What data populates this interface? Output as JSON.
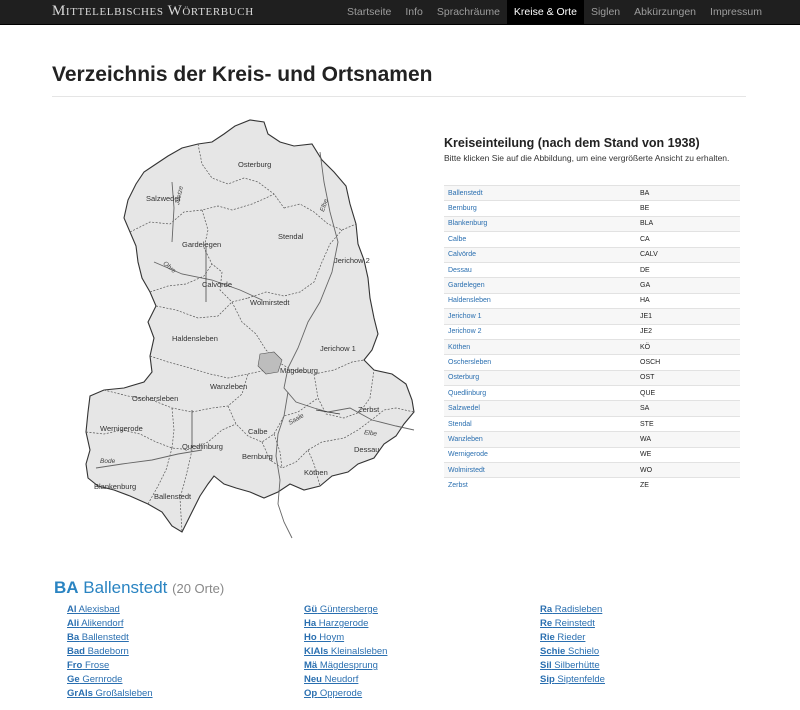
{
  "brand": "Mittelelbisches Wörterbuch",
  "nav": [
    "Startseite",
    "Info",
    "Sprachräume",
    "Kreise & Orte",
    "Siglen",
    "Abkürzungen",
    "Impressum"
  ],
  "nav_active": "Kreise & Orte",
  "page_title": "Verzeichnis der Kreis- und Ortsnamen",
  "map": {
    "labels": [
      "Osterburg",
      "Salzwedel",
      "Gardelegen",
      "Stendal",
      "Jerichow 2",
      "Calvörde",
      "Wolmirstedt",
      "Haldensleben",
      "Jerichow 1",
      "Magdeburg",
      "Oschersleben",
      "Wanzleben",
      "Zerbst",
      "Wernigerode",
      "Calbe",
      "Dessau",
      "Quedlinburg",
      "Bernburg",
      "Köthen",
      "Blankenburg",
      "Ballenstedt"
    ],
    "rivers": [
      "Jeetze",
      "Elbe",
      "Ohre",
      "Saale",
      "Elbe",
      "Bode"
    ]
  },
  "kreise": {
    "title": "Kreiseinteilung (nach dem Stand von 1938)",
    "description": "Bitte klicken Sie auf die Abbildung, um eine vergrößerte Ansicht zu erhalten.",
    "rows": [
      {
        "name": "Ballenstedt",
        "abbr": "BA"
      },
      {
        "name": "Bernburg",
        "abbr": "BE"
      },
      {
        "name": "Blankenburg",
        "abbr": "BLA"
      },
      {
        "name": "Calbe",
        "abbr": "CA"
      },
      {
        "name": "Calvörde",
        "abbr": "CALV"
      },
      {
        "name": "Dessau",
        "abbr": "DE"
      },
      {
        "name": "Gardelegen",
        "abbr": "GA"
      },
      {
        "name": "Haldensleben",
        "abbr": "HA"
      },
      {
        "name": "Jerichow 1",
        "abbr": "JE1"
      },
      {
        "name": "Jerichow 2",
        "abbr": "JE2"
      },
      {
        "name": "Köthen",
        "abbr": "KÖ"
      },
      {
        "name": "Oschersleben",
        "abbr": "OSCH"
      },
      {
        "name": "Osterburg",
        "abbr": "OST"
      },
      {
        "name": "Quedlinburg",
        "abbr": "QUE"
      },
      {
        "name": "Salzwedel",
        "abbr": "SA"
      },
      {
        "name": "Stendal",
        "abbr": "STE"
      },
      {
        "name": "Wanzleben",
        "abbr": "WA"
      },
      {
        "name": "Wernigerode",
        "abbr": "WE"
      },
      {
        "name": "Wolmirstedt",
        "abbr": "WO"
      },
      {
        "name": "Zerbst",
        "abbr": "ZE"
      }
    ]
  },
  "section": {
    "code": "BA",
    "name": "Ballenstedt",
    "count": "(20 Orte)",
    "columns": [
      [
        {
          "abbr": "Al",
          "name": "Alexisbad"
        },
        {
          "abbr": "Ali",
          "name": "Alikendorf"
        },
        {
          "abbr": "Ba",
          "name": "Ballenstedt"
        },
        {
          "abbr": "Bad",
          "name": "Badeborn"
        },
        {
          "abbr": "Fro",
          "name": "Frose"
        },
        {
          "abbr": "Ge",
          "name": "Gernrode"
        },
        {
          "abbr": "GrAls",
          "name": "Großalsleben"
        }
      ],
      [
        {
          "abbr": "Gü",
          "name": "Güntersberge"
        },
        {
          "abbr": "Ha",
          "name": "Harzgerode"
        },
        {
          "abbr": "Ho",
          "name": "Hoym"
        },
        {
          "abbr": "KlAls",
          "name": "Kleinalsleben"
        },
        {
          "abbr": "Mä",
          "name": "Mägdesprung"
        },
        {
          "abbr": "Neu",
          "name": "Neudorf"
        },
        {
          "abbr": "Op",
          "name": "Opperode"
        }
      ],
      [
        {
          "abbr": "Ra",
          "name": "Radisleben"
        },
        {
          "abbr": "Re",
          "name": "Reinstedt"
        },
        {
          "abbr": "Rie",
          "name": "Rieder"
        },
        {
          "abbr": "Schie",
          "name": "Schielo"
        },
        {
          "abbr": "Sil",
          "name": "Silberhütte"
        },
        {
          "abbr": "Sip",
          "name": "Siptenfelde"
        }
      ]
    ]
  }
}
